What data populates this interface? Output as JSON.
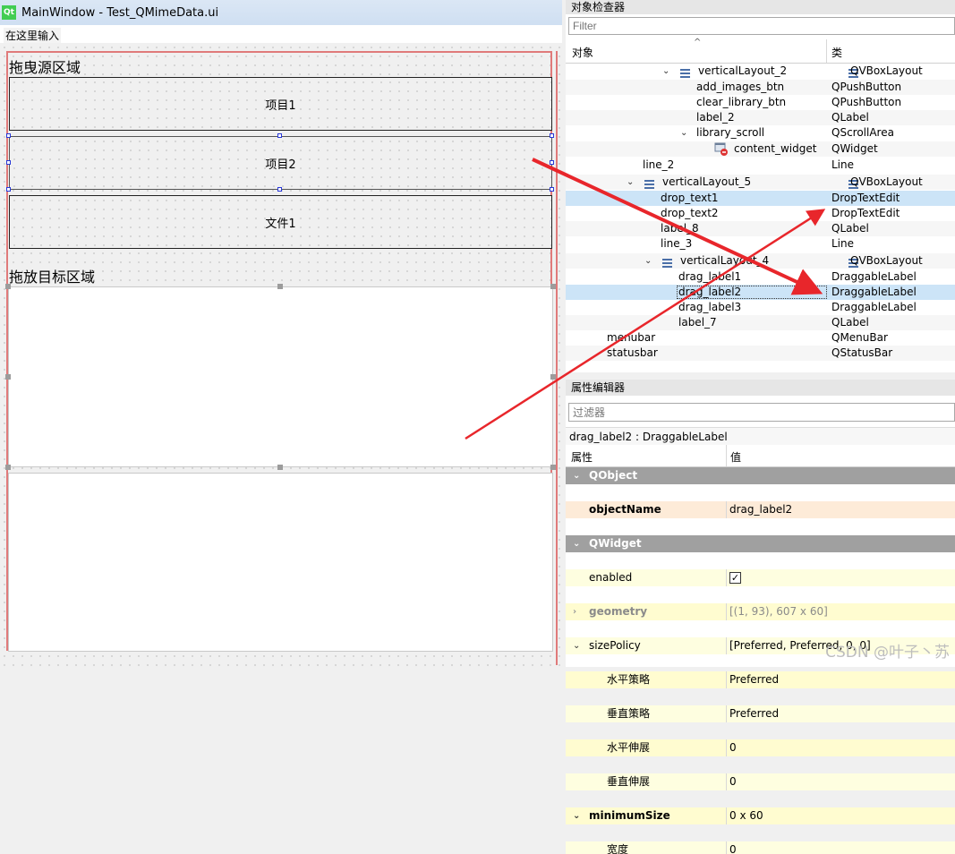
{
  "window": {
    "title": "MainWindow - Test_QMimeData.ui",
    "logo": "Qt"
  },
  "menubar": {
    "placeholder": "在这里输入"
  },
  "form": {
    "source_title": "拖曳源区域",
    "items": [
      "项目1",
      "项目2",
      "文件1"
    ],
    "target_title": "拖放目标区域"
  },
  "object_inspector": {
    "title": "对象检查器",
    "filter_placeholder": "Filter",
    "col_object": "对象",
    "col_class": "类",
    "rows": [
      {
        "name": "verticalLayout_2",
        "cls": "QVBoxLayout"
      },
      {
        "name": "add_images_btn",
        "cls": "QPushButton"
      },
      {
        "name": "clear_library_btn",
        "cls": "QPushButton"
      },
      {
        "name": "label_2",
        "cls": "QLabel"
      },
      {
        "name": "library_scroll",
        "cls": "QScrollArea"
      },
      {
        "name": "content_widget",
        "cls": "QWidget"
      },
      {
        "name": "line_2",
        "cls": "Line"
      },
      {
        "name": "verticalLayout_5",
        "cls": "QVBoxLayout"
      },
      {
        "name": "drop_text1",
        "cls": "DropTextEdit"
      },
      {
        "name": "drop_text2",
        "cls": "DropTextEdit"
      },
      {
        "name": "label_8",
        "cls": "QLabel"
      },
      {
        "name": "line_3",
        "cls": "Line"
      },
      {
        "name": "verticalLayout_4",
        "cls": "QVBoxLayout"
      },
      {
        "name": "drag_label1",
        "cls": "DraggableLabel"
      },
      {
        "name": "drag_label2",
        "cls": "DraggableLabel"
      },
      {
        "name": "drag_label3",
        "cls": "DraggableLabel"
      },
      {
        "name": "label_7",
        "cls": "QLabel"
      },
      {
        "name": "menubar",
        "cls": "QMenuBar"
      },
      {
        "name": "statusbar",
        "cls": "QStatusBar"
      }
    ]
  },
  "property_editor": {
    "title": "属性编辑器",
    "filter_placeholder": "过滤器",
    "current": "drag_label2 : DraggableLabel",
    "col_prop": "属性",
    "col_value": "值",
    "group_qobject": "QObject",
    "objectName_label": "objectName",
    "objectName_value": "drag_label2",
    "group_qwidget": "QWidget",
    "enabled_label": "enabled",
    "enabled_value": true,
    "geometry_label": "geometry",
    "geometry_value": "[(1, 93), 607 x 60]",
    "sizePolicy_label": "sizePolicy",
    "sizePolicy_value": "[Preferred, Preferred, 0, 0]",
    "hpolicy_label": "水平策略",
    "hpolicy_value": "Preferred",
    "vpolicy_label": "垂直策略",
    "vpolicy_value": "Preferred",
    "hstretch_label": "水平伸展",
    "hstretch_value": "0",
    "vstretch_label": "垂直伸展",
    "vstretch_value": "0",
    "minsize_label": "minimumSize",
    "minsize_value": "0 x 60",
    "width_label": "宽度",
    "width_value": "0"
  },
  "watermark": "CSDN @叶子丶苏",
  "colors": {
    "arrow": "#e8262b",
    "selection": "#cce4f7",
    "group": "#a0a0a0"
  }
}
